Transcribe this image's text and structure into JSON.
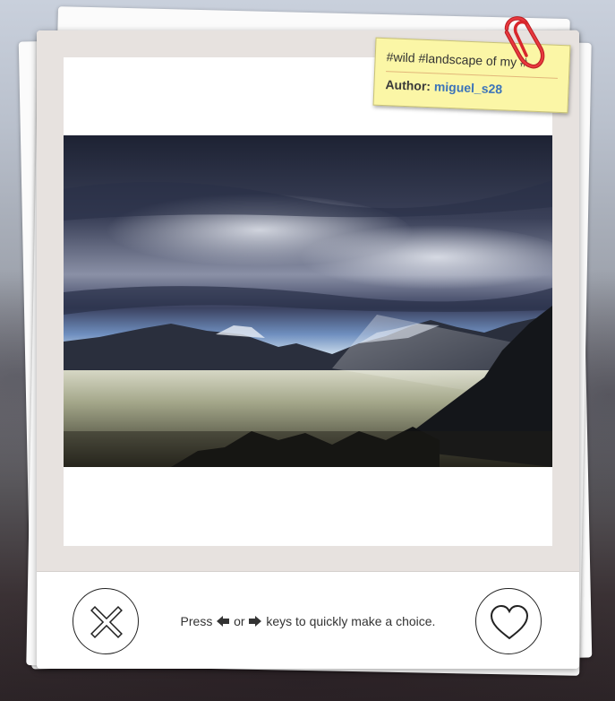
{
  "note": {
    "tags": "#wild #landscape of my #...",
    "author_label": "Author:",
    "author_name": "miguel_s28"
  },
  "photo": {
    "subject": "misty valley with mountains under dramatic cloudy sky"
  },
  "actions": {
    "reject_icon": "close-icon",
    "like_icon": "heart-icon",
    "hint_press": "Press",
    "hint_or": "or",
    "hint_rest": "keys to quickly make a choice.",
    "left_key_icon": "left-arrow-icon",
    "right_key_icon": "right-arrow-icon"
  },
  "colors": {
    "note_bg": "#fbf6a6",
    "author_link": "#3b73b9",
    "clip_red": "#d8262c",
    "photo_mat": "#e7e2df"
  }
}
